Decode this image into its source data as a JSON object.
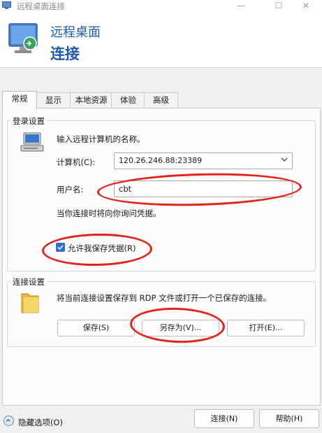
{
  "window": {
    "title": "远程桌面连接",
    "controls": {
      "minimize": "—",
      "maximize": "☐",
      "close": "✕"
    }
  },
  "banner": {
    "line1": "远程桌面",
    "line2": "连接",
    "icon": "remote-desktop-monitor-icon"
  },
  "tabs": [
    {
      "label": "常规",
      "active": true
    },
    {
      "label": "显示",
      "active": false
    },
    {
      "label": "本地资源",
      "active": false
    },
    {
      "label": "体验",
      "active": false
    },
    {
      "label": "高级",
      "active": false
    }
  ],
  "login_settings": {
    "group_label": "登录设置",
    "prompt": "输入远程计算机的名称。",
    "computer_label": "计算机(C):",
    "computer_value": "120.26.246.88:23389",
    "username_label": "用户名:",
    "username_value": "cbt",
    "credential_note": "当你连接时将向你询问凭据。",
    "save_credentials_label": "允许我保存凭据(R)",
    "save_credentials_checked": true
  },
  "connection_settings": {
    "group_label": "连接设置",
    "description": "将当前连接设置保存到 RDP 文件或打开一个已保存的连接。",
    "save_label": "保存(S)",
    "save_as_label": "另存为(V)...",
    "open_label": "打开(E)..."
  },
  "footer": {
    "hide_options_label": "隐藏选项(O)",
    "connect_label": "连接(N)",
    "help_label": "帮助(H)"
  },
  "annotation_color": "#e3231a",
  "accent_color": "#1d5aa8"
}
